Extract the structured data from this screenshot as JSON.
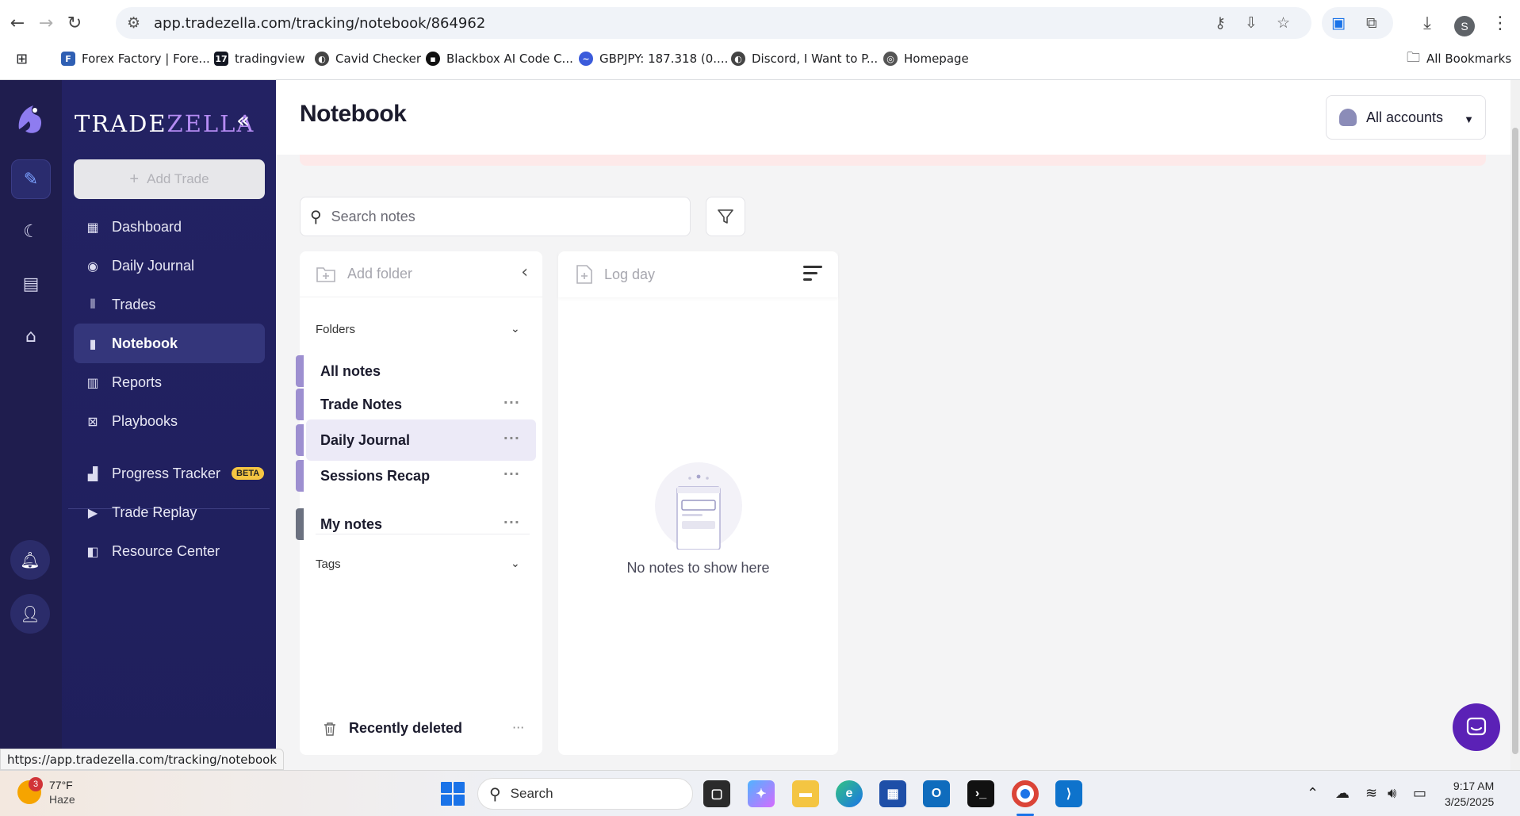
{
  "browser": {
    "url": "app.tradezella.com/tracking/notebook/864962",
    "profile_initial": "S",
    "bookmarks": [
      {
        "label": "Forex Factory | Fore...",
        "icon": "forexfactory-icon",
        "color": "#2f5fb3"
      },
      {
        "label": "tradingview",
        "icon": "tradingview-icon",
        "color": "#131722"
      },
      {
        "label": "Cavid Checker",
        "icon": "globe-icon",
        "color": "#444444"
      },
      {
        "label": "Blackbox AI Code C...",
        "icon": "blackbox-icon",
        "color": "#111111"
      },
      {
        "label": "GBPJPY: 187.318 (0....",
        "icon": "chart-icon",
        "color": "#3b5bdb"
      },
      {
        "label": "Discord, I Want to P...",
        "icon": "globe-icon",
        "color": "#444444"
      },
      {
        "label": "Homepage",
        "icon": "homepage-icon",
        "color": "#555555"
      }
    ],
    "all_bookmarks": "All Bookmarks",
    "status_url": "https://app.tradezella.com/tracking/notebook"
  },
  "sidebar": {
    "brand": "TRADE",
    "brand_accent": "ZELLA",
    "add_trade": "Add Trade",
    "items": [
      {
        "label": "Dashboard",
        "icon": "dashboard-icon"
      },
      {
        "label": "Daily Journal",
        "icon": "journal-icon"
      },
      {
        "label": "Trades",
        "icon": "trades-icon"
      },
      {
        "label": "Notebook",
        "icon": "notebook-icon"
      },
      {
        "label": "Reports",
        "icon": "reports-icon"
      },
      {
        "label": "Playbooks",
        "icon": "playbooks-icon"
      },
      {
        "label": "Progress Tracker",
        "icon": "progress-icon",
        "badge": "BETA"
      },
      {
        "label": "Trade Replay",
        "icon": "replay-icon"
      },
      {
        "label": "Resource Center",
        "icon": "resource-icon"
      }
    ],
    "active_item": "Notebook"
  },
  "header": {
    "title": "Notebook",
    "account_selector": "All accounts"
  },
  "notes": {
    "search_placeholder": "Search notes",
    "add_folder": "Add folder",
    "folders_label": "Folders",
    "folders": [
      {
        "label": "All notes"
      },
      {
        "label": "Trade Notes"
      },
      {
        "label": "Daily Journal"
      },
      {
        "label": "Sessions Recap"
      }
    ],
    "selected_folder": "Daily Journal",
    "my_notes": "My notes",
    "tags_label": "Tags",
    "recently_deleted": "Recently deleted",
    "log_day": "Log day",
    "empty_message": "No notes to show here"
  },
  "taskbar": {
    "weather_temp": "77°F",
    "weather_desc": "Haze",
    "weather_badge": "3",
    "search_label": "Search",
    "time": "9:17 AM",
    "date": "3/25/2025"
  }
}
